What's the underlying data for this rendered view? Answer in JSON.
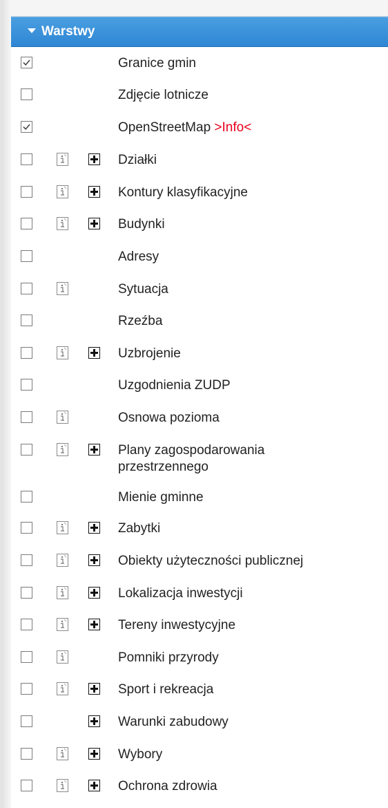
{
  "panel": {
    "title": "Warstwy"
  },
  "layers": [
    {
      "label": "Granice gmin",
      "checked": true,
      "info": false,
      "expand": false
    },
    {
      "label": "Zdjęcie lotnicze",
      "checked": false,
      "info": false,
      "expand": false
    },
    {
      "label": "OpenStreetMap",
      "link": ">Info<",
      "checked": true,
      "info": false,
      "expand": false
    },
    {
      "label": "Działki",
      "checked": false,
      "info": true,
      "expand": true
    },
    {
      "label": "Kontury klasyfikacyjne",
      "checked": false,
      "info": true,
      "expand": true
    },
    {
      "label": "Budynki",
      "checked": false,
      "info": true,
      "expand": true
    },
    {
      "label": "Adresy",
      "checked": false,
      "info": false,
      "expand": false
    },
    {
      "label": "Sytuacja",
      "checked": false,
      "info": true,
      "expand": false
    },
    {
      "label": "Rzeźba",
      "checked": false,
      "info": false,
      "expand": false
    },
    {
      "label": "Uzbrojenie",
      "checked": false,
      "info": true,
      "expand": true
    },
    {
      "label": "Uzgodnienia ZUDP",
      "checked": false,
      "info": false,
      "expand": false
    },
    {
      "label": "Osnowa pozioma",
      "checked": false,
      "info": true,
      "expand": false
    },
    {
      "label": "Plany zagospodarowania przestrzennego",
      "checked": false,
      "info": true,
      "expand": true
    },
    {
      "label": "Mienie gminne",
      "checked": false,
      "info": false,
      "expand": false
    },
    {
      "label": "Zabytki",
      "checked": false,
      "info": true,
      "expand": true
    },
    {
      "label": "Obiekty użyteczności publicznej",
      "checked": false,
      "info": true,
      "expand": true
    },
    {
      "label": "Lokalizacja inwestycji",
      "checked": false,
      "info": true,
      "expand": true
    },
    {
      "label": "Tereny inwestycyjne",
      "checked": false,
      "info": true,
      "expand": true
    },
    {
      "label": "Pomniki przyrody",
      "checked": false,
      "info": true,
      "expand": false
    },
    {
      "label": "Sport i rekreacja",
      "checked": false,
      "info": true,
      "expand": true
    },
    {
      "label": "Warunki zabudowy",
      "checked": false,
      "info": false,
      "expand": true
    },
    {
      "label": "Wybory",
      "checked": false,
      "info": true,
      "expand": true
    },
    {
      "label": "Ochrona zdrowia",
      "checked": false,
      "info": true,
      "expand": true
    }
  ],
  "icons": {
    "caret": "caret-down-icon",
    "info": "info-icon",
    "expand": "expand-plus-icon",
    "check": "checkmark-icon"
  },
  "colors": {
    "header_bg": "#3a90db",
    "header_text": "#ffffff",
    "link": "#e8001c",
    "text": "#222222"
  }
}
